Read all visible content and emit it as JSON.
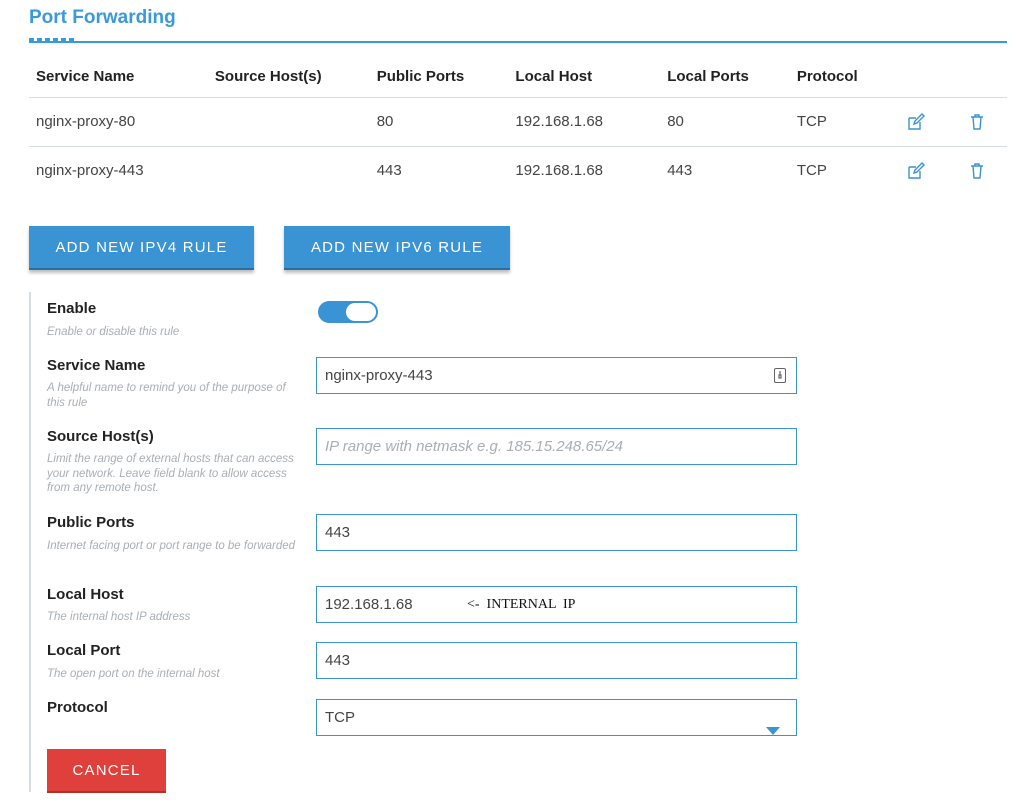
{
  "title": "Port Forwarding",
  "table": {
    "headers": [
      "Service Name",
      "Source Host(s)",
      "Public Ports",
      "Local Host",
      "Local Ports",
      "Protocol"
    ],
    "rows": [
      {
        "service": "nginx-proxy-80",
        "source": "",
        "public": "80",
        "local_host": "192.168.1.68",
        "local_ports": "80",
        "protocol": "TCP"
      },
      {
        "service": "nginx-proxy-443",
        "source": "",
        "public": "443",
        "local_host": "192.168.1.68",
        "local_ports": "443",
        "protocol": "TCP"
      }
    ],
    "row_icons": [
      "edit-icon",
      "trash-icon"
    ]
  },
  "buttons": {
    "add_ipv4": "ADD NEW IPV4 RULE",
    "add_ipv6": "ADD NEW IPV6 RULE",
    "cancel": "CANCEL"
  },
  "form": {
    "enable": {
      "label": "Enable",
      "help": "Enable or disable this rule",
      "value": true
    },
    "service_name": {
      "label": "Service Name",
      "help": "A helpful name to remind you of the purpose of this rule",
      "value": "nginx-proxy-443"
    },
    "source_hosts": {
      "label": "Source Host(s)",
      "help": "Limit the range of external hosts that can access your network. Leave field blank to allow access from any remote host.",
      "value": "",
      "placeholder": "IP range with netmask e.g. 185.15.248.65/24"
    },
    "public_ports": {
      "label": "Public Ports",
      "help": "Internet facing port or port range to be forwarded",
      "value": "443"
    },
    "local_host": {
      "label": "Local Host",
      "help": "The internal host IP address",
      "value": "192.168.1.68",
      "annotation": "<-  INTERNAL  IP"
    },
    "local_port": {
      "label": "Local Port",
      "help": "The open port on the internal host",
      "value": "443"
    },
    "protocol": {
      "label": "Protocol",
      "value": "TCP"
    }
  },
  "colors": {
    "accent": "#3a93d3",
    "danger": "#e0403b"
  }
}
